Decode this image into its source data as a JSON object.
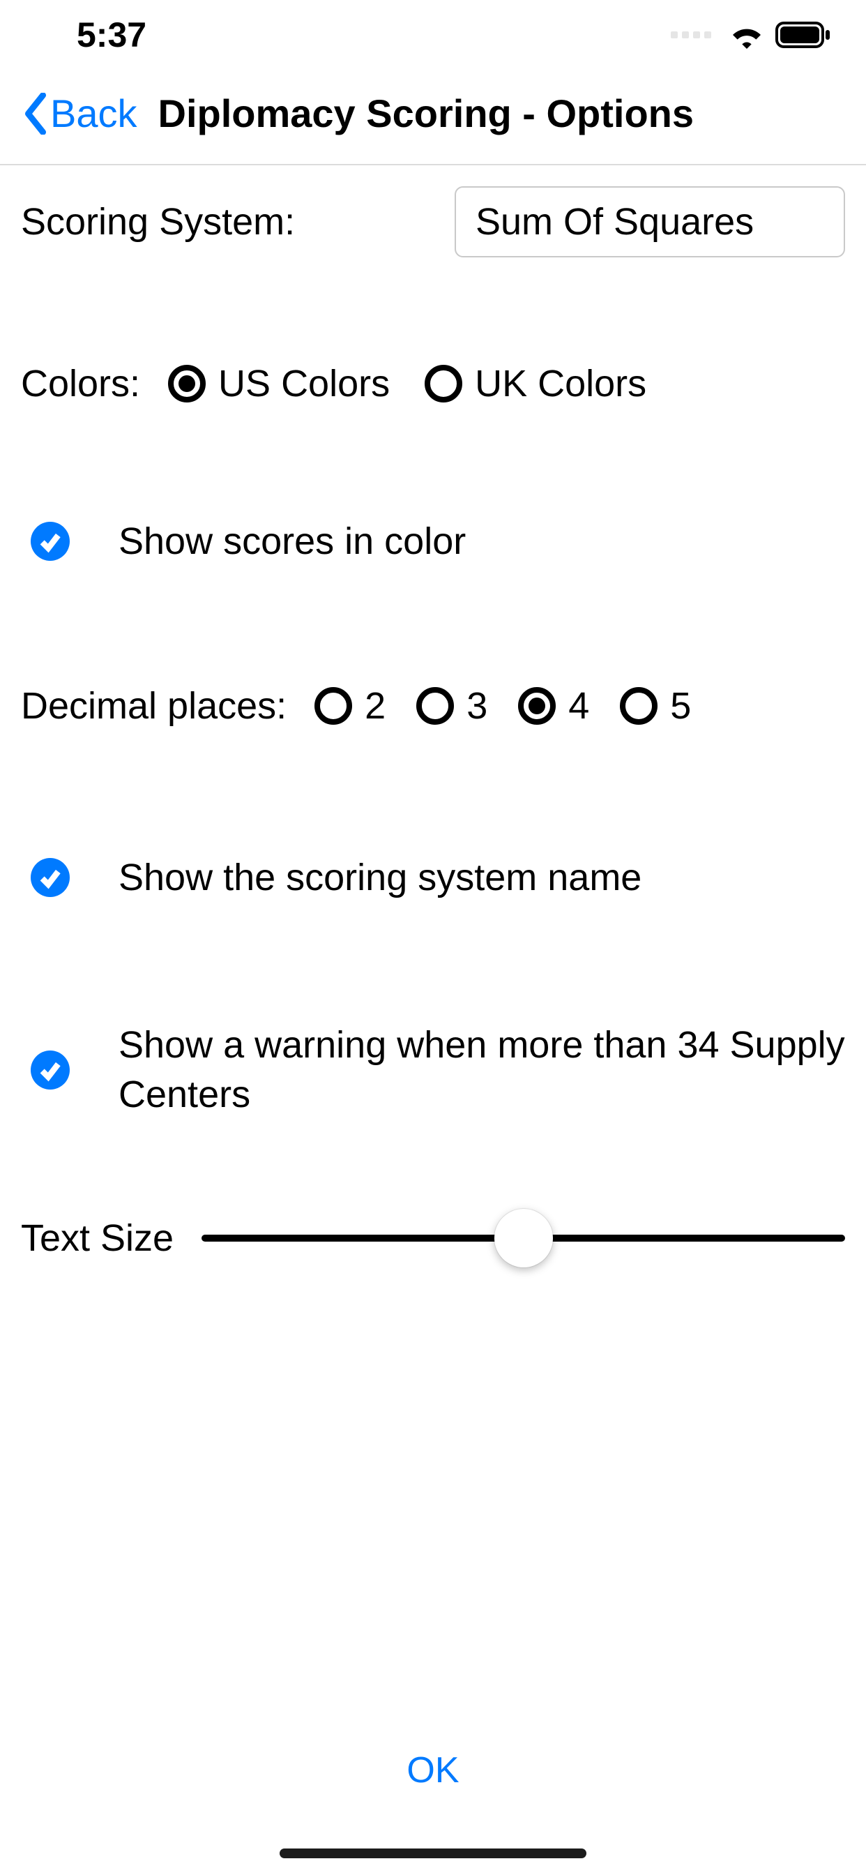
{
  "status": {
    "time": "5:37"
  },
  "nav": {
    "back_label": "Back",
    "title": "Diplomacy Scoring - Options"
  },
  "scoring": {
    "label": "Scoring System:",
    "value": "Sum Of Squares"
  },
  "colors": {
    "label": "Colors:",
    "options": [
      "US Colors",
      "UK Colors"
    ],
    "selected": "US Colors"
  },
  "show_color": {
    "label": "Show scores in color",
    "checked": true
  },
  "decimal": {
    "label": "Decimal places:",
    "options": [
      "2",
      "3",
      "4",
      "5"
    ],
    "selected": "4"
  },
  "show_name": {
    "label": "Show the scoring system name",
    "checked": true
  },
  "show_warning": {
    "label": "Show a warning when more than 34 Supply Centers",
    "checked": true
  },
  "text_size": {
    "label": "Text Size",
    "value_percent": 50
  },
  "ok_label": "OK"
}
